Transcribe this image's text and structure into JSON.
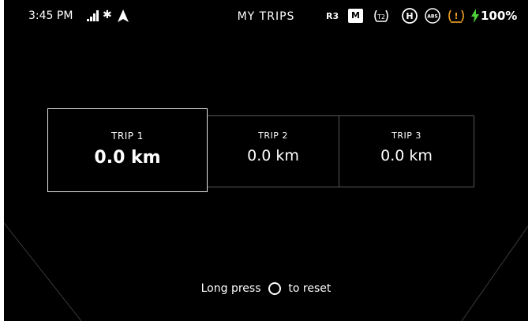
{
  "status": {
    "time": "3:45 PM",
    "bluetooth_glyph": "✱",
    "title": "MY TRIPS",
    "gear": "R3",
    "ride_mode": "M",
    "battery": "100%",
    "icons": [
      "signal-icon",
      "bluetooth-icon",
      "navigation-icon",
      "tire-pressure-icon",
      "headlight-icon",
      "abs-icon",
      "warning-icon",
      "charging-bolt-icon"
    ],
    "tpms_label": "T2",
    "headlight_label": "H",
    "abs_label": "ABS",
    "warning_label": "!"
  },
  "trips": [
    {
      "name": "TRIP 1",
      "value": "0.0 km"
    },
    {
      "name": "TRIP 2",
      "value": "0.0 km"
    },
    {
      "name": "TRIP 3",
      "value": "0.0 km"
    }
  ],
  "hint": {
    "prefix": "Long press",
    "suffix": "to reset"
  },
  "colors": {
    "background": "#000000",
    "text": "#ffffff",
    "warning": "#f5a623",
    "bolt": "#4cd137",
    "selected_border": "#e6e6e6",
    "cell_border": "#555555"
  }
}
